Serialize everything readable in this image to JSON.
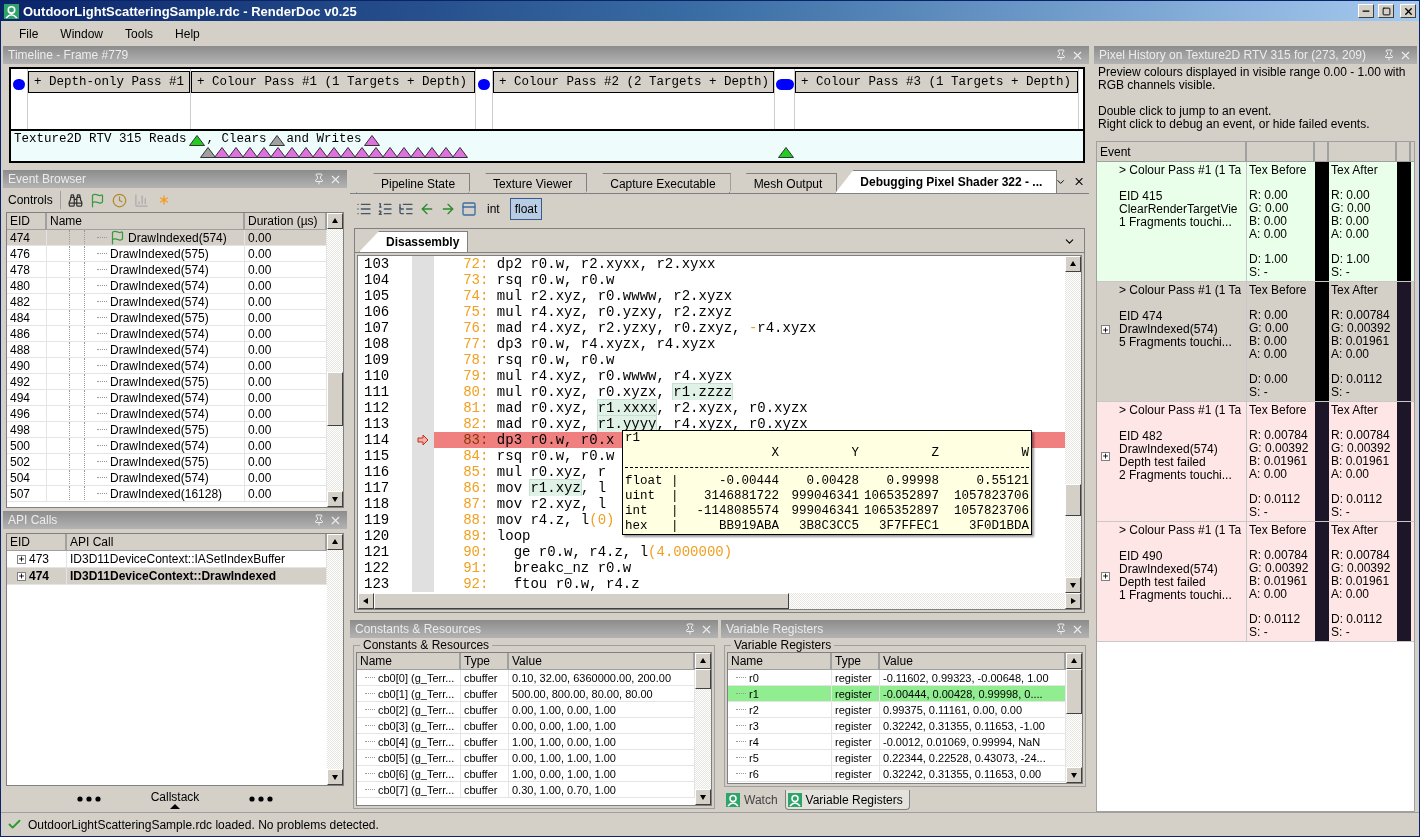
{
  "window": {
    "title": "OutdoorLightScatteringSample.rdc - RenderDoc v0.25"
  },
  "menu": [
    "File",
    "Window",
    "Tools",
    "Help"
  ],
  "timeline": {
    "title": "Timeline - Frame #779",
    "items": [
      {
        "kind": "dot"
      },
      {
        "kind": "pass",
        "label": "+ Depth-only Pass #1"
      },
      {
        "kind": "pass",
        "label": "+ Colour Pass #1 (1 Targets + Depth)"
      },
      {
        "kind": "dot"
      },
      {
        "kind": "pass",
        "label": "+ Colour Pass #2 (2 Targets + Depth)"
      },
      {
        "kind": "wide-dot"
      },
      {
        "kind": "pass",
        "label": "+ Colour Pass #3 (1 Targets + Depth)"
      }
    ],
    "legend": [
      {
        "text": "Texture2D RTV 315 Reads",
        "kind": "read"
      },
      {
        "text": ", Clears",
        "kind": "clear"
      },
      {
        "text": "and Writes",
        "kind": "write"
      }
    ],
    "marker_groups": [
      {
        "markers": [
          {
            "kind": "clear"
          },
          {
            "kind": "write"
          },
          {
            "kind": "write"
          },
          {
            "kind": "write"
          },
          {
            "kind": "write"
          },
          {
            "kind": "write"
          },
          {
            "kind": "write"
          },
          {
            "kind": "write"
          },
          {
            "kind": "write"
          },
          {
            "kind": "write"
          },
          {
            "kind": "write"
          },
          {
            "kind": "write"
          },
          {
            "kind": "write"
          },
          {
            "kind": "write"
          },
          {
            "kind": "write"
          },
          {
            "kind": "write"
          },
          {
            "kind": "write"
          },
          {
            "kind": "write"
          },
          {
            "kind": "write"
          }
        ]
      },
      {
        "markers": [
          {
            "kind": "read"
          }
        ]
      }
    ]
  },
  "event_browser": {
    "title": "Event Browser",
    "controls_label": "Controls",
    "columns": [
      "EID",
      "Name",
      "Duration (µs)"
    ],
    "rows": [
      {
        "eid": "474",
        "name": "DrawIndexed(574)",
        "duration": "0.00",
        "selected": true,
        "bookmarked": true
      },
      {
        "eid": "476",
        "name": "DrawIndexed(575)",
        "duration": "0.00",
        "selected": false,
        "bookmarked": false
      },
      {
        "eid": "478",
        "name": "DrawIndexed(574)",
        "duration": "0.00",
        "selected": false,
        "bookmarked": false
      },
      {
        "eid": "480",
        "name": "DrawIndexed(574)",
        "duration": "0.00",
        "selected": false,
        "bookmarked": false
      },
      {
        "eid": "482",
        "name": "DrawIndexed(574)",
        "duration": "0.00",
        "selected": false,
        "bookmarked": false
      },
      {
        "eid": "484",
        "name": "DrawIndexed(575)",
        "duration": "0.00",
        "selected": false,
        "bookmarked": false
      },
      {
        "eid": "486",
        "name": "DrawIndexed(574)",
        "duration": "0.00",
        "selected": false,
        "bookmarked": false
      },
      {
        "eid": "488",
        "name": "DrawIndexed(574)",
        "duration": "0.00",
        "selected": false,
        "bookmarked": false
      },
      {
        "eid": "490",
        "name": "DrawIndexed(574)",
        "duration": "0.00",
        "selected": false,
        "bookmarked": false
      },
      {
        "eid": "492",
        "name": "DrawIndexed(575)",
        "duration": "0.00",
        "selected": false,
        "bookmarked": false
      },
      {
        "eid": "494",
        "name": "DrawIndexed(574)",
        "duration": "0.00",
        "selected": false,
        "bookmarked": false
      },
      {
        "eid": "496",
        "name": "DrawIndexed(574)",
        "duration": "0.00",
        "selected": false,
        "bookmarked": false
      },
      {
        "eid": "498",
        "name": "DrawIndexed(575)",
        "duration": "0.00",
        "selected": false,
        "bookmarked": false
      },
      {
        "eid": "500",
        "name": "DrawIndexed(574)",
        "duration": "0.00",
        "selected": false,
        "bookmarked": false
      },
      {
        "eid": "502",
        "name": "DrawIndexed(575)",
        "duration": "0.00",
        "selected": false,
        "bookmarked": false
      },
      {
        "eid": "504",
        "name": "DrawIndexed(574)",
        "duration": "0.00",
        "selected": false,
        "bookmarked": false
      },
      {
        "eid": "507",
        "name": "DrawIndexed(16128)",
        "duration": "0.00",
        "selected": false,
        "bookmarked": false
      }
    ]
  },
  "api_calls": {
    "title": "API Calls",
    "columns": [
      "EID",
      "API Call"
    ],
    "rows": [
      {
        "eid": "473",
        "call": "ID3D11DeviceContext::IASetIndexBuffer",
        "selected": false
      },
      {
        "eid": "474",
        "call": "ID3D11DeviceContext::DrawIndexed",
        "selected": true
      }
    ],
    "callstack": "Callstack"
  },
  "doc_tabs": [
    {
      "label": "Pipeline State",
      "selected": false
    },
    {
      "label": "Texture Viewer",
      "selected": false
    },
    {
      "label": "Capture Executable",
      "selected": false
    },
    {
      "label": "Mesh Output",
      "selected": false
    },
    {
      "label": "Debugging Pixel Shader 322 - ...",
      "selected": true
    }
  ],
  "toolbar": {
    "formats": [
      {
        "label": "int",
        "selected": false
      },
      {
        "label": "float",
        "selected": true
      }
    ]
  },
  "editor": {
    "tab": "Disassembly",
    "lines": [
      {
        "num": "103",
        "idx": "72:",
        "current": false,
        "parts": [
          {
            "t": "dp2 r0.w, r2.xyxx, r2.xyxx"
          }
        ]
      },
      {
        "num": "104",
        "idx": "73:",
        "current": false,
        "parts": [
          {
            "t": "rsq r0.w, r0.w"
          }
        ]
      },
      {
        "num": "105",
        "idx": "74:",
        "current": false,
        "parts": [
          {
            "t": "mul r2.xyz, r0.wwww, r2.xyzx"
          }
        ]
      },
      {
        "num": "106",
        "idx": "75:",
        "current": false,
        "parts": [
          {
            "t": "mul r4.xyz, r0.yzxy, r2.zxyz"
          }
        ]
      },
      {
        "num": "107",
        "idx": "76:",
        "current": false,
        "parts": [
          {
            "t": "mad r4.xyz, r2.yzxy, r0.zxyz, "
          },
          {
            "t": "-",
            "kind": "lit"
          },
          {
            "t": "r4.xyzx"
          }
        ]
      },
      {
        "num": "108",
        "idx": "77:",
        "current": false,
        "parts": [
          {
            "t": "dp3 r0.w, r4.xyzx, r4.xyzx"
          }
        ]
      },
      {
        "num": "109",
        "idx": "78:",
        "current": false,
        "parts": [
          {
            "t": "rsq r0.w, r0.w"
          }
        ]
      },
      {
        "num": "110",
        "idx": "79:",
        "current": false,
        "parts": [
          {
            "t": "mul r4.xyz, r0.wwww, r4.xyzx"
          }
        ]
      },
      {
        "num": "111",
        "idx": "80:",
        "current": false,
        "parts": [
          {
            "t": "mul r0.xyz, r0.xyzx, "
          },
          {
            "t": "r1.zzzz",
            "kind": "hl"
          }
        ]
      },
      {
        "num": "112",
        "idx": "81:",
        "current": false,
        "parts": [
          {
            "t": "mad r0.xyz, "
          },
          {
            "t": "r1.xxxx",
            "kind": "hl"
          },
          {
            "t": ", r2.xyzx, r0.xyzx"
          }
        ]
      },
      {
        "num": "113",
        "idx": "82:",
        "current": false,
        "parts": [
          {
            "t": "mad r0.xyz, "
          },
          {
            "t": "r1.yyyy",
            "kind": "hl"
          },
          {
            "t": ", r4.xyzx, r0.xyzx"
          }
        ]
      },
      {
        "num": "114",
        "idx": "83:",
        "current": true,
        "parts": [
          {
            "t": "dp3 r0.w, r0.x"
          }
        ]
      },
      {
        "num": "115",
        "idx": "84:",
        "current": false,
        "parts": [
          {
            "t": "rsq r0.w, r0.w"
          }
        ]
      },
      {
        "num": "116",
        "idx": "85:",
        "current": false,
        "parts": [
          {
            "t": "mul r0.xyz, r"
          }
        ]
      },
      {
        "num": "117",
        "idx": "86:",
        "current": false,
        "parts": [
          {
            "t": "mov "
          },
          {
            "t": "r1.xyz",
            "kind": "hl"
          },
          {
            "t": ", l"
          }
        ]
      },
      {
        "num": "118",
        "idx": "87:",
        "current": false,
        "parts": [
          {
            "t": "mov r2.xyz, l"
          }
        ]
      },
      {
        "num": "119",
        "idx": "88:",
        "current": false,
        "parts": [
          {
            "t": "mov r4.z, l"
          },
          {
            "t": "(0)",
            "kind": "lit"
          }
        ]
      },
      {
        "num": "120",
        "idx": "89:",
        "current": false,
        "parts": [
          {
            "t": "loop"
          }
        ]
      },
      {
        "num": "121",
        "idx": "90:",
        "current": false,
        "parts": [
          {
            "t": "  ge r0.w, r4.z, l"
          },
          {
            "t": "(4.000000)",
            "kind": "lit"
          }
        ]
      },
      {
        "num": "122",
        "idx": "91:",
        "current": false,
        "parts": [
          {
            "t": "  breakc_nz r0.w"
          }
        ]
      },
      {
        "num": "123",
        "idx": "92:",
        "current": false,
        "parts": [
          {
            "t": "  ftou r0.w, r4.z"
          }
        ]
      }
    ],
    "tooltip": {
      "title": "r1",
      "columns": [
        "X",
        "Y",
        "Z",
        "W"
      ],
      "rows": [
        {
          "label": "float",
          "sep": "|",
          "values": [
            "-0.00444",
            "0.00428",
            "0.99998",
            "0.55121"
          ]
        },
        {
          "label": "uint",
          "sep": "|",
          "values": [
            "3146881722",
            "999046341",
            "1065352897",
            "1057823706"
          ]
        },
        {
          "label": "int",
          "sep": "|",
          "values": [
            "-1148085574",
            "999046341",
            "1065352897",
            "1057823706"
          ]
        },
        {
          "label": "hex",
          "sep": "|",
          "values": [
            "BB919ABA",
            "3B8C3CC5",
            "3F7FFEC1",
            "3F0D1BDA"
          ]
        }
      ]
    }
  },
  "constants": {
    "title": "Constants & Resources",
    "group": "Constants & Resources",
    "columns": [
      "Name",
      "Type",
      "Value"
    ],
    "rows": [
      {
        "name": "cb0[0] (g_Terr...",
        "type": "cbuffer",
        "value": "0.10, 32.00, 6360000.00, 200.00"
      },
      {
        "name": "cb0[1] (g_Terr...",
        "type": "cbuffer",
        "value": "500.00, 800.00, 80.00, 80.00"
      },
      {
        "name": "cb0[2] (g_Terr...",
        "type": "cbuffer",
        "value": "0.00, 1.00, 0.00, 1.00"
      },
      {
        "name": "cb0[3] (g_Terr...",
        "type": "cbuffer",
        "value": "0.00, 0.00, 1.00, 1.00"
      },
      {
        "name": "cb0[4] (g_Terr...",
        "type": "cbuffer",
        "value": "1.00, 1.00, 0.00, 1.00"
      },
      {
        "name": "cb0[5] (g_Terr...",
        "type": "cbuffer",
        "value": "0.00, 1.00, 1.00, 1.00"
      },
      {
        "name": "cb0[6] (g_Terr...",
        "type": "cbuffer",
        "value": "1.00, 0.00, 1.00, 1.00"
      },
      {
        "name": "cb0[7] (g_Terr...",
        "type": "cbuffer",
        "value": "0.30, 1.00, 0.70, 1.00"
      }
    ]
  },
  "registers": {
    "title": "Variable Registers",
    "group": "Variable Registers",
    "columns": [
      "Name",
      "Type",
      "Value"
    ],
    "rows": [
      {
        "name": "r0",
        "type": "register",
        "value": "-0.11602, 0.99323, -0.00648, 1.00",
        "selected": false
      },
      {
        "name": "r1",
        "type": "register",
        "value": "-0.00444, 0.00428, 0.99998, 0....",
        "selected": true
      },
      {
        "name": "r2",
        "type": "register",
        "value": "0.99375, 0.11161, 0.00, 0.00",
        "selected": false
      },
      {
        "name": "r3",
        "type": "register",
        "value": "0.32242, 0.31355, 0.11653, -1.00",
        "selected": false
      },
      {
        "name": "r4",
        "type": "register",
        "value": "-0.0012, 0.01069, 0.99994, NaN",
        "selected": false
      },
      {
        "name": "r5",
        "type": "register",
        "value": "0.22344, 0.22528, 0.43073, -24...",
        "selected": false
      },
      {
        "name": "r6",
        "type": "register",
        "value": "0.32242, 0.31355, 0.11653, 0.00",
        "selected": false
      }
    ],
    "tabs": [
      {
        "label": "Watch",
        "selected": false
      },
      {
        "label": "Variable Registers",
        "selected": true
      }
    ]
  },
  "pixel_history": {
    "title": "Pixel History on Texture2D RTV 315 for (273, 209)",
    "notes": [
      "Preview colours displayed in visible range 0.00 - 1.00 with RGB channels visible.",
      "Double click to jump to an event.",
      "Right click to debug an event, or hide failed events."
    ],
    "column": "Event",
    "events": [
      {
        "title": "> Colour Pass #1 (1 Ta",
        "lines": [
          "EID 415",
          "ClearRenderTargetVie",
          "1 Fragments touchi..."
        ],
        "expandable": false,
        "color": "#eaffea",
        "before": {
          "label": "Tex Before",
          "rgba": [
            "R: 0.00",
            "G: 0.00",
            "B: 0.00",
            "A: 0.00"
          ],
          "ds": [
            "D: 1.00",
            "S: -"
          ],
          "color": "#000000"
        },
        "after": {
          "label": "Tex After",
          "rgba": [
            "R: 0.00",
            "G: 0.00",
            "B: 0.00",
            "A: 0.00"
          ],
          "ds": [
            "D: 1.00",
            "S: -"
          ],
          "color": "#000000"
        }
      },
      {
        "title": "> Colour Pass #1 (1 Ta",
        "lines": [
          "EID 474",
          "DrawIndexed(574)",
          "5 Fragments touchi..."
        ],
        "expandable": true,
        "color": "#d4d0c8",
        "before": {
          "label": "Tex Before",
          "rgba": [
            "R: 0.00",
            "G: 0.00",
            "B: 0.00",
            "A: 0.00"
          ],
          "ds": [
            "D: 0.00",
            "S: -"
          ],
          "color": "#000000"
        },
        "after": {
          "label": "Tex After",
          "rgba": [
            "R: 0.00784",
            "G: 0.00392",
            "B: 0.01961",
            "A: 0.00"
          ],
          "ds": [
            "D: 0.0112",
            "S: -"
          ],
          "color": "#1c1628"
        }
      },
      {
        "title": "> Colour Pass #1 (1 Ta",
        "lines": [
          "EID 482",
          "DrawIndexed(574)",
          "Depth test failed",
          "2 Fragments touchi..."
        ],
        "expandable": true,
        "color": "#ffe6e6",
        "before": {
          "label": "Tex Before",
          "rgba": [
            "R: 0.00784",
            "G: 0.00392",
            "B: 0.01961",
            "A: 0.00"
          ],
          "ds": [
            "D: 0.0112",
            "S: -"
          ],
          "color": "#1c1628"
        },
        "after": {
          "label": "Tex After",
          "rgba": [
            "R: 0.00784",
            "G: 0.00392",
            "B: 0.01961",
            "A: 0.00"
          ],
          "ds": [
            "D: 0.0112",
            "S: -"
          ],
          "color": "#1c1628"
        }
      },
      {
        "title": "> Colour Pass #1 (1 Ta",
        "lines": [
          "EID 490",
          "DrawIndexed(574)",
          "Depth test failed",
          "1 Fragments touchi..."
        ],
        "expandable": true,
        "color": "#ffe6e6",
        "before": {
          "label": "Tex Before",
          "rgba": [
            "R: 0.00784",
            "G: 0.00392",
            "B: 0.01961",
            "A: 0.00"
          ],
          "ds": [
            "D: 0.0112",
            "S: -"
          ],
          "color": "#1c1628"
        },
        "after": {
          "label": "Tex After",
          "rgba": [
            "R: 0.00784",
            "G: 0.00392",
            "B: 0.01961",
            "A: 0.00"
          ],
          "ds": [
            "D: 0.0112",
            "S: -"
          ],
          "color": "#1c1628"
        }
      }
    ]
  },
  "status": "OutdoorLightScatteringSample.rdc loaded. No problems detected."
}
